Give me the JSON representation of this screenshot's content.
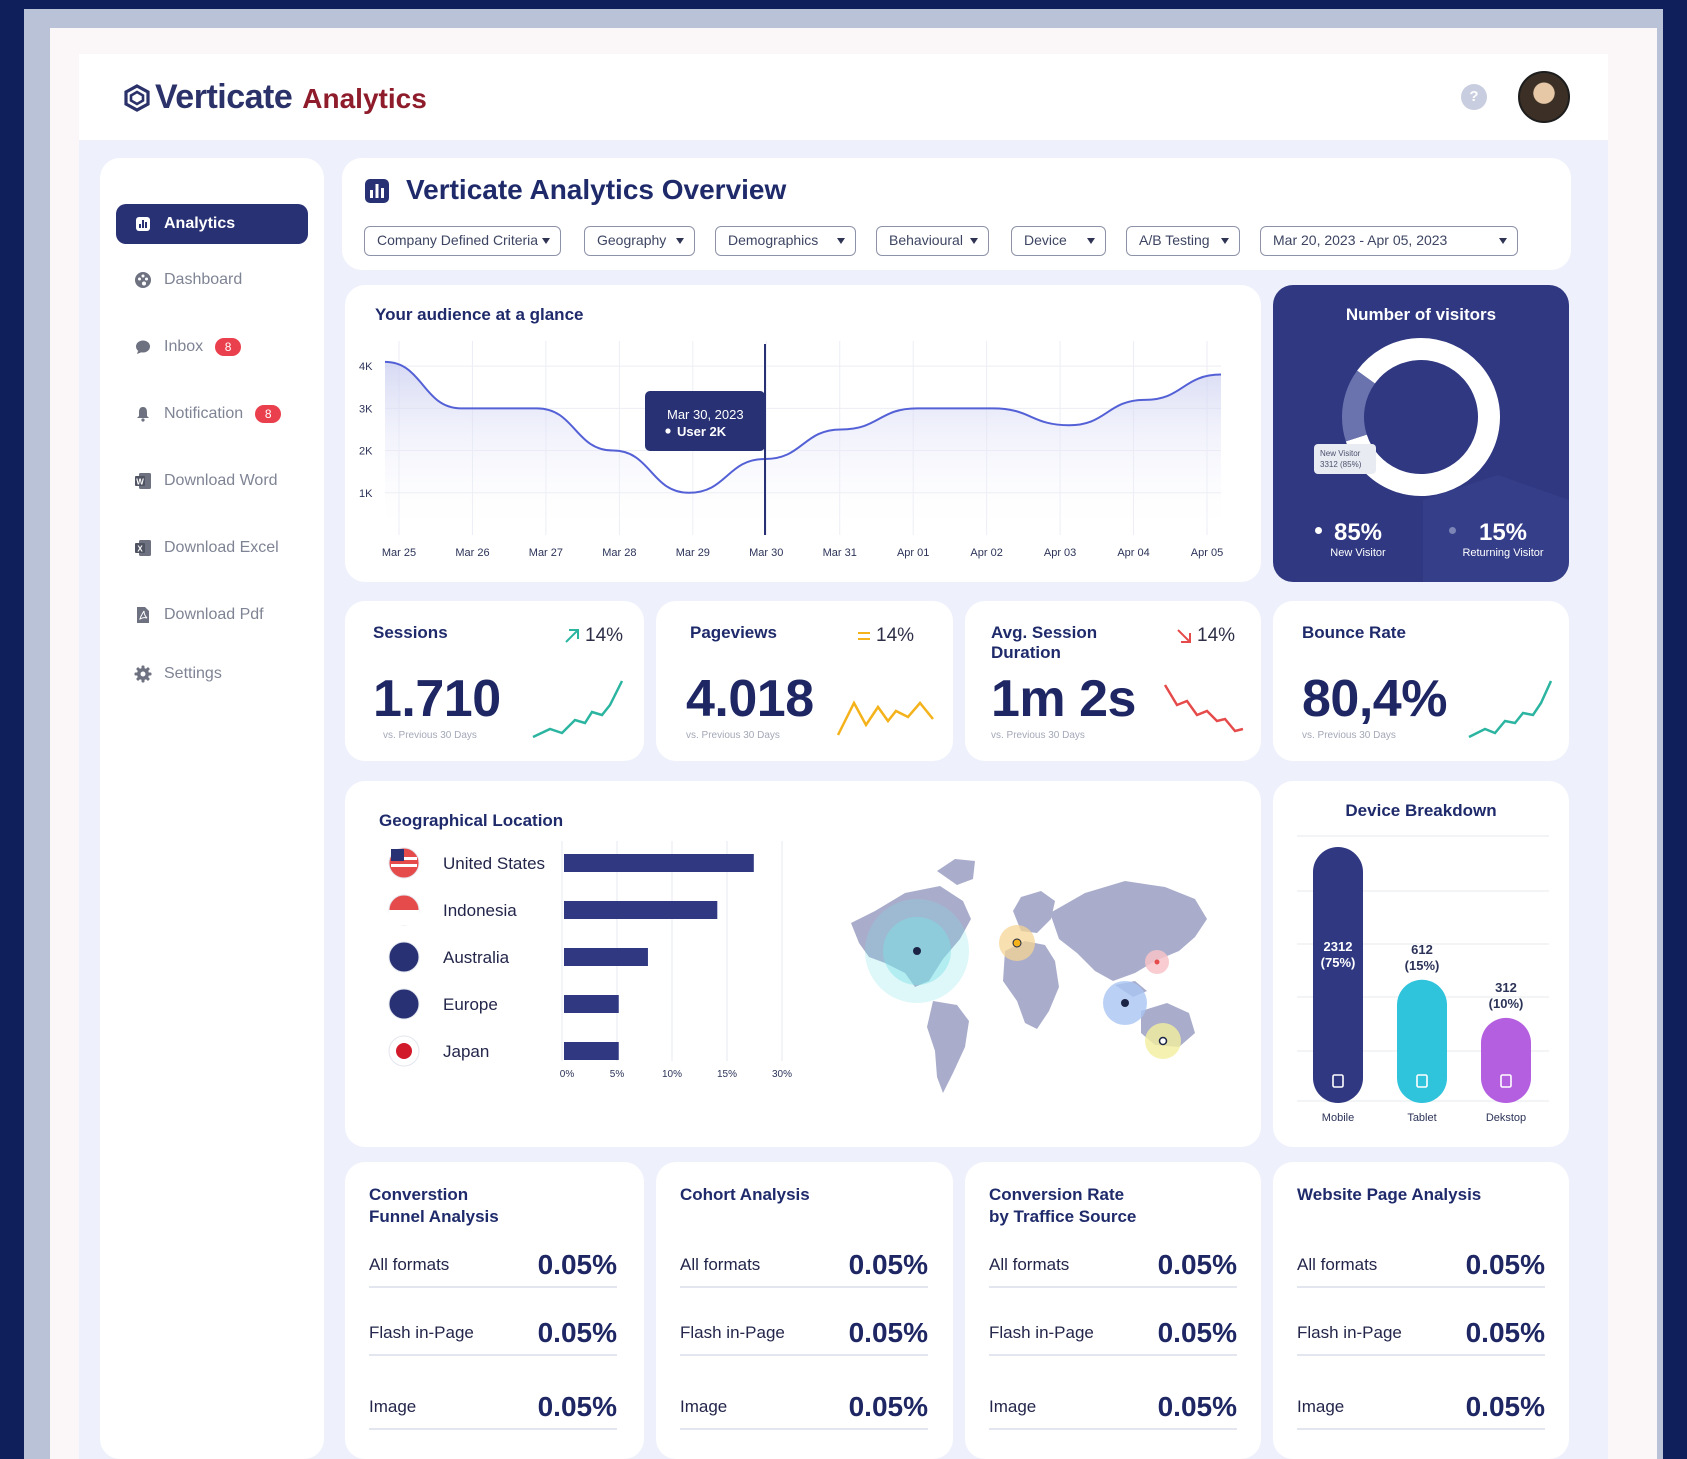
{
  "brand": {
    "name": "Verticate",
    "suffix": "Analytics"
  },
  "header": {
    "help_label": "?"
  },
  "sidebar": {
    "items": [
      {
        "label": "Analytics",
        "icon": "chart-icon",
        "active": true
      },
      {
        "label": "Dashboard",
        "icon": "palette-icon"
      },
      {
        "label": "Inbox",
        "icon": "chat-icon",
        "badge": "8"
      },
      {
        "label": "Notification",
        "icon": "bell-icon",
        "badge": "8"
      },
      {
        "label": "Download Word",
        "icon": "word-icon"
      },
      {
        "label": "Download Excel",
        "icon": "excel-icon"
      },
      {
        "label": "Download Pdf",
        "icon": "pdf-icon"
      },
      {
        "label": "Settings",
        "icon": "gear-icon"
      }
    ]
  },
  "overview": {
    "title": "Verticate Analytics Overview",
    "filters": [
      "Company Defined Criteria",
      "Geography",
      "Demographics",
      "Behavioural",
      "Device",
      "A/B Testing",
      "Mar 20, 2023 - Apr 05, 2023"
    ]
  },
  "audience": {
    "title": "Your audience at a glance",
    "tooltip_date": "Mar 30, 2023",
    "tooltip_value": "User 2K"
  },
  "visitors": {
    "title": "Number of visitors",
    "tooltip_line1": "New Visitor",
    "tooltip_line2": "3312 (85%)",
    "new_pct": "85%",
    "new_label": "New Visitor",
    "returning_pct": "15%",
    "returning_label": "Returning Visitor"
  },
  "kpis": [
    {
      "title": "Sessions",
      "title2": "",
      "change": "14%",
      "trend": "up",
      "value": "1.710",
      "sub": "vs. Previous 30 Days"
    },
    {
      "title": "Pageviews",
      "title2": "",
      "change": "14%",
      "trend": "flat",
      "value": "4.018",
      "sub": "vs. Previous 30 Days"
    },
    {
      "title": "Avg. Session",
      "title2": "Duration",
      "change": "14%",
      "trend": "down",
      "value": "1m 2s",
      "sub": "vs. Previous 30 Days"
    },
    {
      "title": "Bounce Rate",
      "title2": "",
      "change": "",
      "trend": "up",
      "value": "80,4%",
      "sub": "vs. Previous 30 Days"
    }
  ],
  "geo": {
    "title": "Geographical Location"
  },
  "device": {
    "title": "Device Breakdown"
  },
  "tables": [
    {
      "title": "Converstion",
      "title2": "Funnel Analysis",
      "rows": [
        {
          "label": "All formats",
          "value": "0.05%"
        },
        {
          "label": "Flash in-Page",
          "value": "0.05%"
        },
        {
          "label": "Image",
          "value": "0.05%"
        }
      ]
    },
    {
      "title": "Cohort Analysis",
      "title2": "",
      "rows": [
        {
          "label": "All formats",
          "value": "0.05%"
        },
        {
          "label": "Flash in-Page",
          "value": "0.05%"
        },
        {
          "label": "Image",
          "value": "0.05%"
        }
      ]
    },
    {
      "title": "Conversion Rate",
      "title2": "by Traffice Source",
      "rows": [
        {
          "label": "All formats",
          "value": "0.05%"
        },
        {
          "label": "Flash in-Page",
          "value": "0.05%"
        },
        {
          "label": "Image",
          "value": "0.05%"
        }
      ]
    },
    {
      "title": "Website Page Analysis",
      "title2": "",
      "rows": [
        {
          "label": "All formats",
          "value": "0.05%"
        },
        {
          "label": "Flash in-Page",
          "value": "0.05%"
        },
        {
          "label": "Image",
          "value": "0.05%"
        }
      ]
    }
  ],
  "colors": {
    "navy": "#2f3881",
    "teal": "#2bb5a0",
    "orange": "#f4b21b",
    "red": "#e64b4b",
    "cyan": "#2fc3dc",
    "purple": "#b45ee0"
  },
  "chart_data": [
    {
      "type": "area",
      "title": "Your audience at a glance",
      "x": [
        "Mar 25",
        "Mar 26",
        "Mar 27",
        "Mar 28",
        "Mar 29",
        "Mar 30",
        "Mar 31",
        "Apr 01",
        "Apr 02",
        "Apr 03",
        "Apr 04",
        "Apr 05"
      ],
      "yticks": [
        "1K",
        "2K",
        "3K",
        "4K"
      ],
      "ylim": [
        0,
        4500
      ],
      "series": [
        {
          "values": [
            4100,
            3000,
            3000,
            2000,
            1000,
            1800,
            2500,
            3000,
            3000,
            2600,
            3200,
            3800
          ]
        }
      ],
      "grid": true
    },
    {
      "type": "pie",
      "title": "Number of visitors",
      "categories": [
        "New Visitor",
        "Returning Visitor"
      ],
      "values": [
        85,
        15
      ]
    },
    {
      "type": "bar",
      "title": "Geographical Location",
      "orientation": "horizontal",
      "categories": [
        "United States",
        "Indonesia",
        "Australia",
        "Europe",
        "Japan"
      ],
      "values": [
        26,
        21,
        11.5,
        7.5,
        7.5
      ],
      "xticks": [
        "0%",
        "5%",
        "10%",
        "15%",
        "30%"
      ]
    },
    {
      "type": "bar",
      "title": "Device Breakdown",
      "categories": [
        "Mobile",
        "Tablet",
        "Dekstop"
      ],
      "values": [
        2312,
        612,
        312
      ],
      "labels": [
        "2312",
        "612",
        "312"
      ],
      "labels2": [
        "(75%)",
        "(15%)",
        "(10%)"
      ]
    }
  ]
}
